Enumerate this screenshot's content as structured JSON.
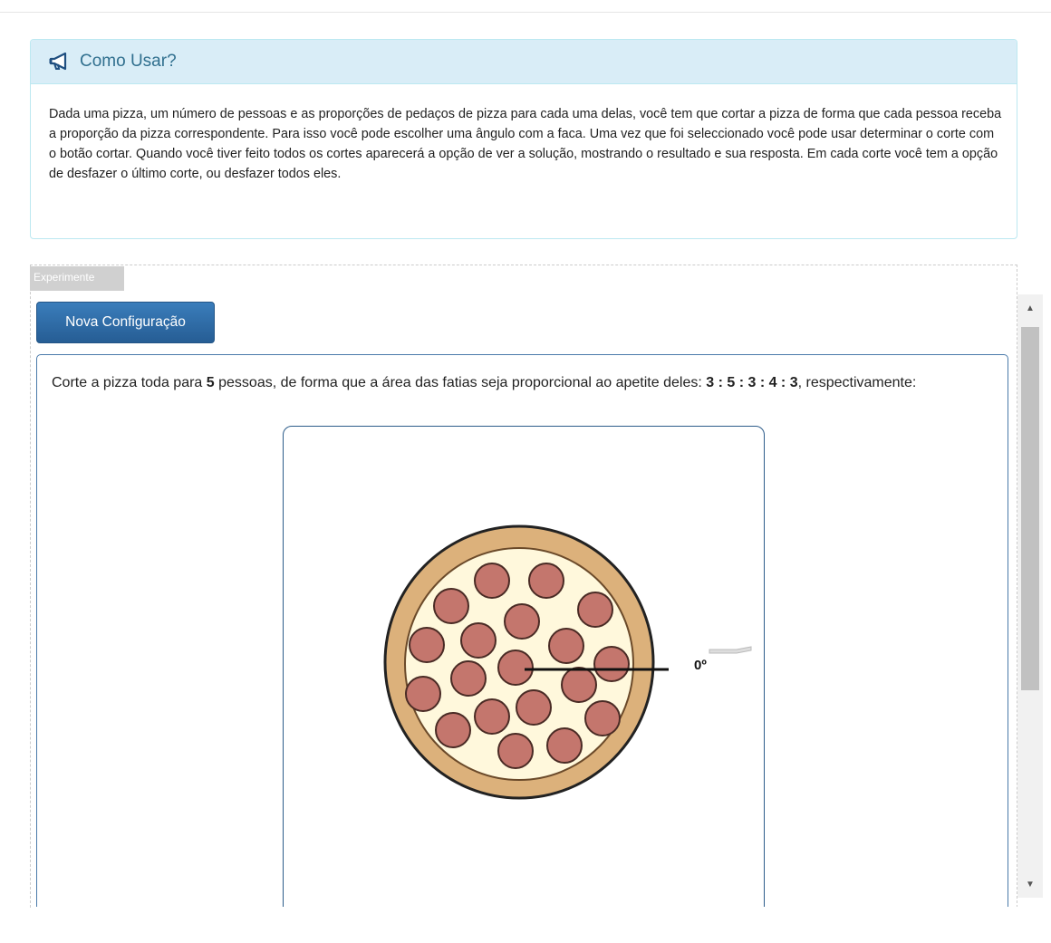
{
  "info": {
    "title": "Como Usar?",
    "body": "Dada uma pizza, um número de pessoas e as proporções de pedaços de pizza para cada uma delas, você tem que cortar a pizza de forma que cada pessoa receba a proporção da pizza correspondente. Para isso você pode escolher uma ângulo com a faca. Uma vez que foi seleccionado você pode usar determinar o corte com o botão cortar. Quando você tiver feito todos os cortes aparecerá a opção de ver a solução, mostrando o resultado e sua resposta. Em cada corte você tem a opção de desfazer o último corte, ou desfazer todos eles.",
    "icon": "bullhorn-icon"
  },
  "experiment": {
    "legend": "Experimente",
    "new_config_label": "Nova Configuração"
  },
  "question": {
    "prefix": "Corte a pizza toda para ",
    "people": "5",
    "middle": " pessoas, de forma que a área das fatias seja proporcional ao apetite deles: ",
    "ratios": "3 : 5 : 3 : 4 : 3",
    "suffix": ", respectivamente:"
  },
  "pizza": {
    "angle_label": "0º",
    "colors": {
      "crust": "#dcb17b",
      "cheese": "#fff8dc",
      "pepperoni": "#c4766d",
      "line": "#111111"
    }
  },
  "scrollbar": {
    "up_icon": "arrow-up-icon",
    "down_icon": "arrow-down-icon"
  }
}
